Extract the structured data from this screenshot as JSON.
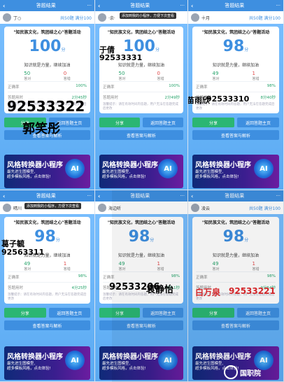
{
  "common": {
    "back_glyph": "‹",
    "page_title": "答题结果",
    "menu_glyph": "···",
    "activity_title": "\"知民族文化，筑团结之心\"答题活动",
    "score_unit": "分",
    "tag": "知识就是力量，继续加油",
    "correct_label": "答对",
    "wrong_label": "答错",
    "rate_label": "正确率",
    "time_label": "答题用时",
    "note": "温馨提示：请在有效时间内答题，用户无法在答题完成后更改",
    "share_btn": "分享",
    "back_btn": "返回答题主页",
    "view_btn": "查看答案与解析",
    "banner_title": "风格转换器小程序",
    "banner_sub1": "最先进生图模型,",
    "banner_sub2": "超多模板风格，点击体验!",
    "banner_ai": "AI",
    "tooltip": "添加到我的小程序，方便下次查看",
    "watermark": "国职院"
  },
  "cells": [
    {
      "user": "丁○",
      "stats": "共50题 满分100",
      "score": "100",
      "correct": "50",
      "wrong": "0",
      "rate": "100%",
      "time": "2分45秒",
      "overlay_num": "92533322",
      "overlay_name": "郭笑彤"
    },
    {
      "user": "·余·",
      "stats": "",
      "score": "100",
      "correct": "50",
      "wrong": "0",
      "rate": "100%",
      "time": "2分49秒",
      "overlay_num": "92533331",
      "overlay_name": "于倩"
    },
    {
      "user": "十月",
      "stats": "共50题 满分100",
      "score": "98",
      "correct": "49",
      "wrong": "1",
      "rate": "98%",
      "time": "8分40秒",
      "overlay_num": "92533310",
      "overlay_name": "苗雨欣"
    },
    {
      "user": "晴川",
      "stats": "",
      "score": "98",
      "correct": "49",
      "wrong": "1",
      "rate": "98%",
      "time": "4分25秒",
      "overlay_num": "92563311",
      "overlay_name": "葛子毓"
    },
    {
      "user": "海边听",
      "stats": "",
      "score": "98",
      "correct": "49",
      "wrong": "1",
      "rate": "98%",
      "time": "4分11秒",
      "overlay_num": "92533206",
      "overlay_name": "袁静怡"
    },
    {
      "user": "凌云",
      "stats": "共50题 满分100",
      "score": "98",
      "correct": "49",
      "wrong": "1",
      "rate": "98%",
      "time": "9分54秒",
      "overlay_num": "92533221",
      "overlay_name": "白万泉"
    }
  ]
}
